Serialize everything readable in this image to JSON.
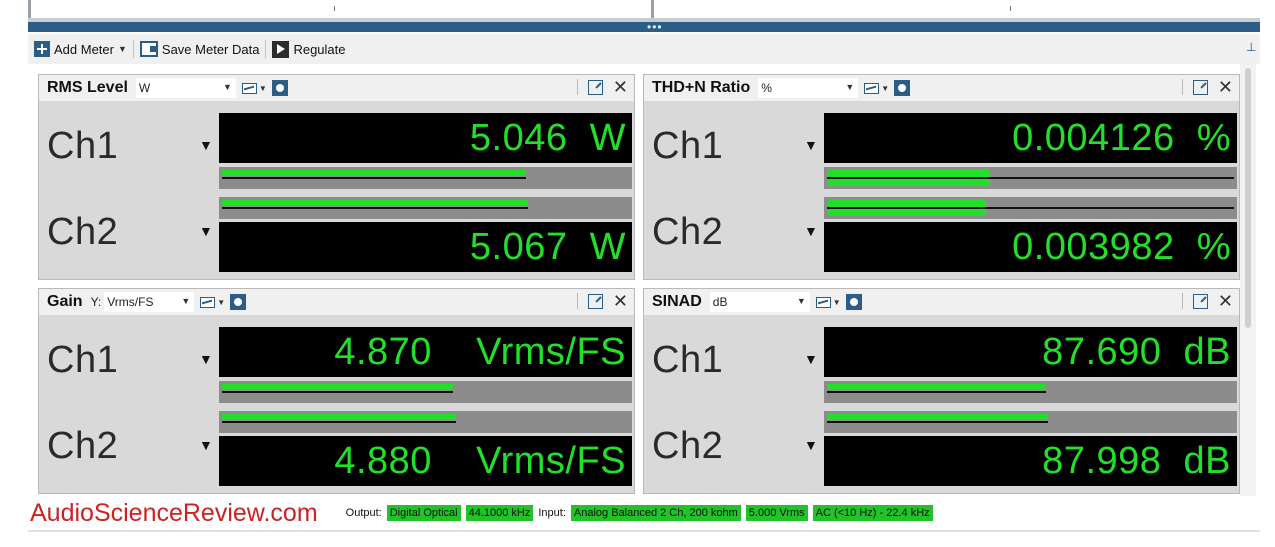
{
  "toolbar": {
    "add_meter_label": "Add Meter",
    "save_meter_data_label": "Save Meter Data",
    "regulate_label": "Regulate"
  },
  "panels": {
    "rms": {
      "title": "RMS Level",
      "unit": "W",
      "ch1": {
        "label": "Ch1",
        "value": "5.046  W",
        "bar_fraction": 0.75
      },
      "ch2": {
        "label": "Ch2",
        "value": "5.067  W",
        "bar_fraction": 0.755
      }
    },
    "thdn": {
      "title": "THD+N Ratio",
      "unit": "%",
      "ch1": {
        "label": "Ch1",
        "value": "0.004126  %",
        "bar_fraction": 0.41
      },
      "ch2": {
        "label": "Ch2",
        "value": "0.003982  %",
        "bar_fraction": 0.4
      }
    },
    "gain": {
      "title": "Gain",
      "unit_prefix": "Y:",
      "unit": "Vrms/FS",
      "ch1": {
        "label": "Ch1",
        "value": "4.870    Vrms/FS",
        "bar_fraction": 0.575
      },
      "ch2": {
        "label": "Ch2",
        "value": "4.880    Vrms/FS",
        "bar_fraction": 0.58
      }
    },
    "sinad": {
      "title": "SINAD",
      "unit": "dB",
      "ch1": {
        "label": "Ch1",
        "value": "87.690  dB",
        "bar_fraction": 0.545
      },
      "ch2": {
        "label": "Ch2",
        "value": "87.998  dB",
        "bar_fraction": 0.55
      }
    }
  },
  "statusbar": {
    "brand": "AudioScienceReview.com",
    "output_label": "Output:",
    "output_value": "Digital Optical",
    "output_rate": "44.1000 kHz",
    "input_label": "Input:",
    "input_value": "Analog Balanced 2 Ch, 200 kohm",
    "input_level": "5.000 Vrms",
    "input_coupling": "AC (<10 Hz) - 22.4 kHz"
  },
  "colors": {
    "accent": "#2c5d86",
    "meter_green": "#22e02a",
    "meter_bg": "#000000",
    "brand_red": "#cc2222"
  }
}
